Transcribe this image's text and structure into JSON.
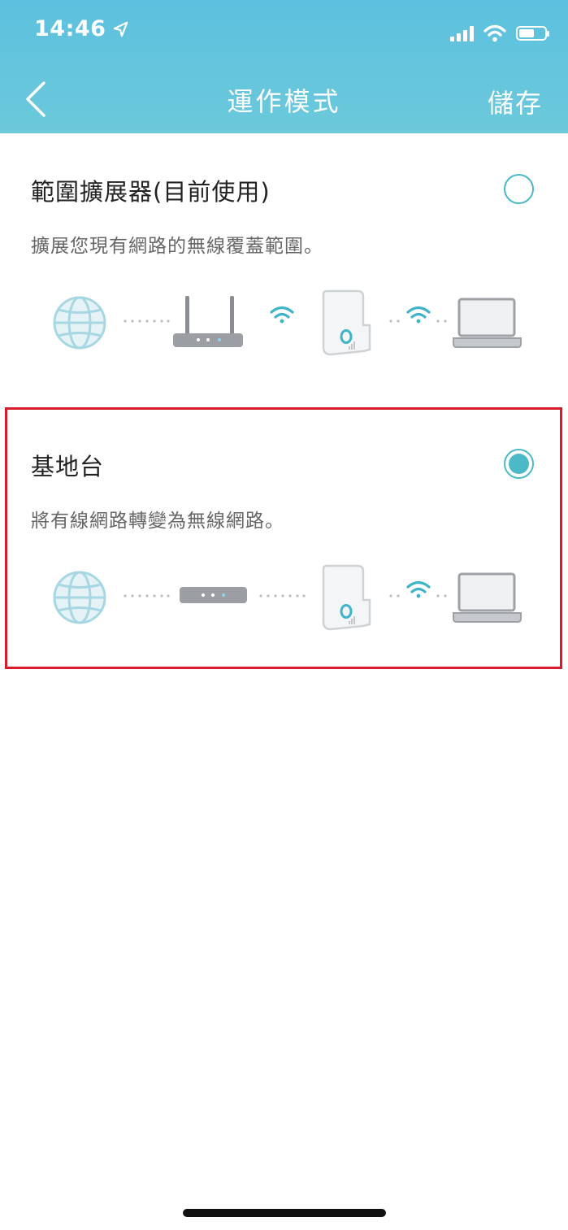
{
  "status_bar": {
    "time": "14:46"
  },
  "header": {
    "title": "運作模式",
    "save_label": "儲存"
  },
  "options": [
    {
      "title": "範圍擴展器(目前使用)",
      "description": "擴展您現有網路的無線覆蓋範圍。",
      "selected": false
    },
    {
      "title": "基地台",
      "description": "將有線網路轉變為無線網路。",
      "selected": true
    }
  ],
  "colors": {
    "header": "#5cc0de",
    "accent": "#4bb9c6",
    "highlight_border": "#d51b2c"
  }
}
